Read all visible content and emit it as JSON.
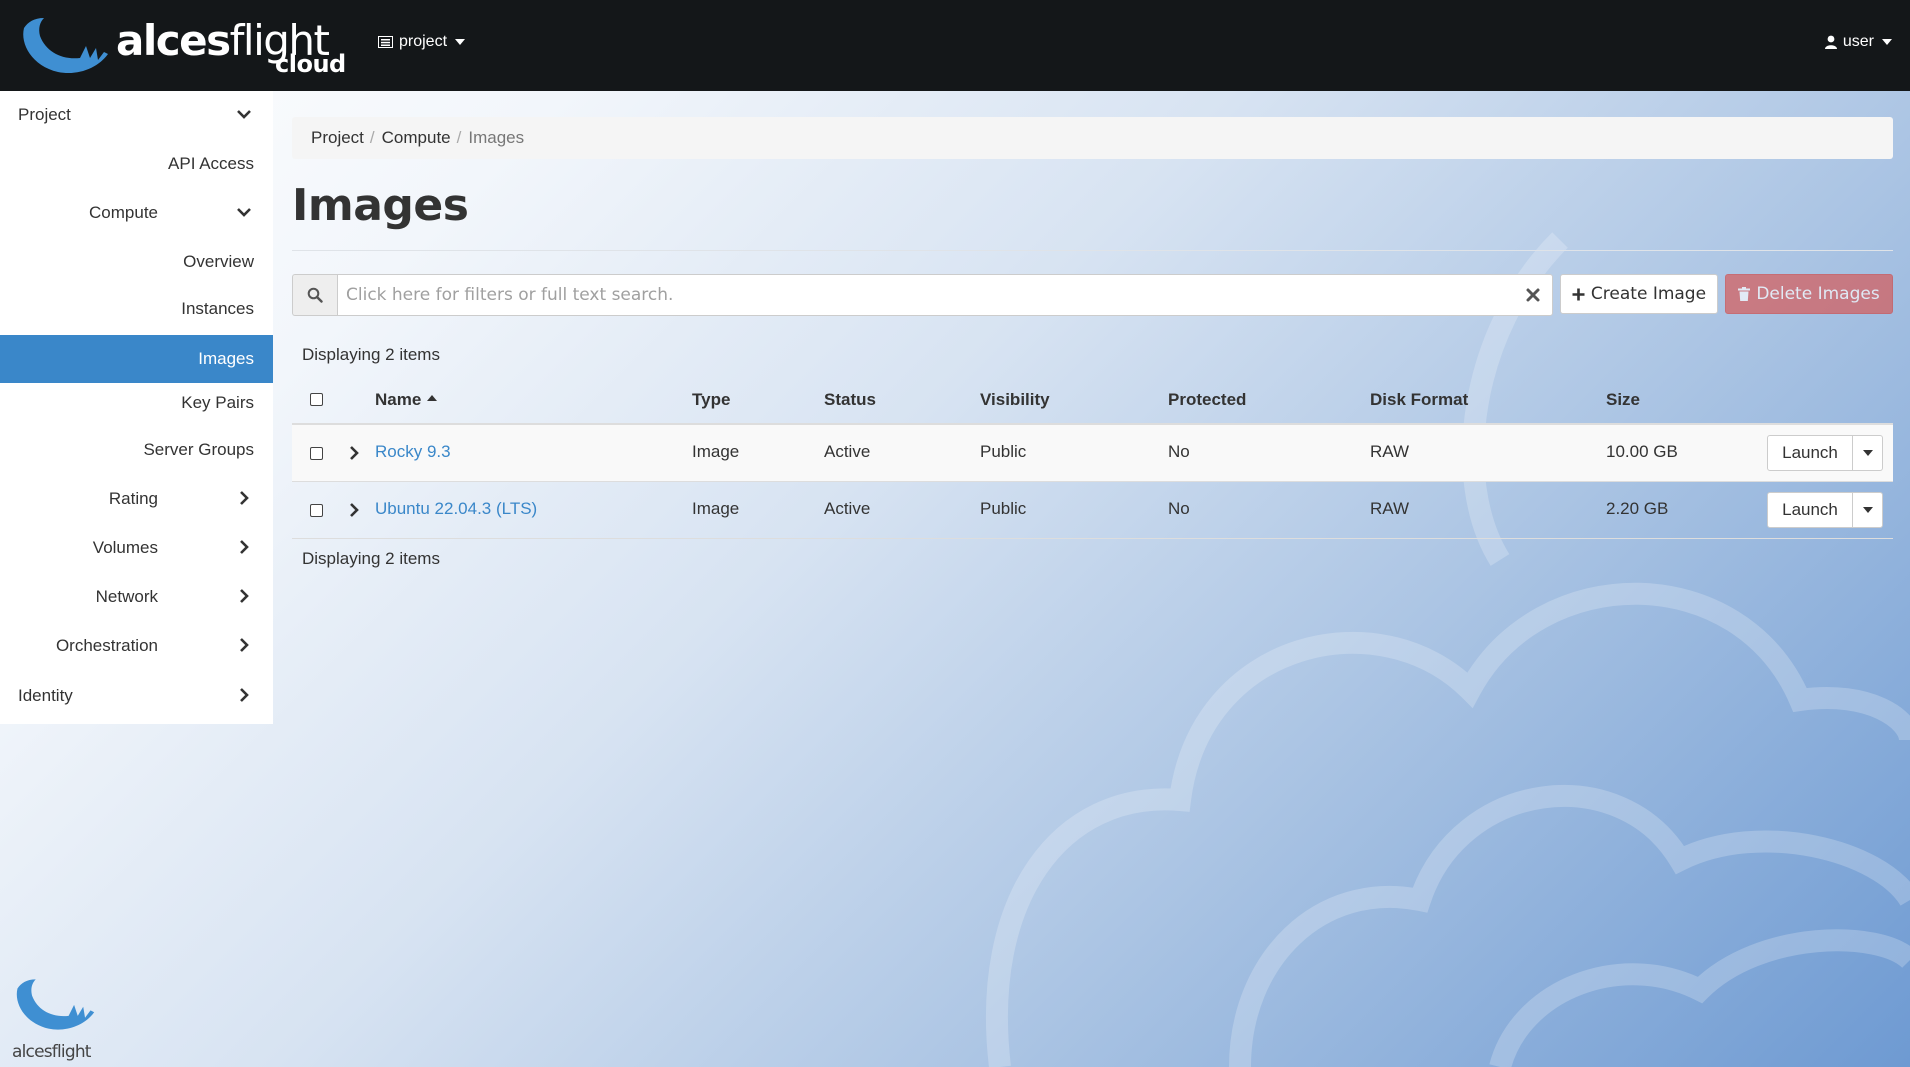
{
  "brand": {
    "name_bold": "alces",
    "name_light": "flight",
    "sub": "cloud"
  },
  "topnav": {
    "project_label": "project",
    "user_label": "user"
  },
  "sidebar": {
    "items": [
      {
        "label": "Project",
        "level": 0,
        "icon": "chevron-down-icon"
      },
      {
        "label": "API Access",
        "level": 2
      },
      {
        "label": "Compute",
        "level": 1,
        "icon": "chevron-down-icon"
      },
      {
        "label": "Overview",
        "level": 2
      },
      {
        "label": "Instances",
        "level": 2
      },
      {
        "label": "Images",
        "level": 2,
        "active": true
      },
      {
        "label": "Key Pairs",
        "level": 2
      },
      {
        "label": "Server Groups",
        "level": 2
      },
      {
        "label": "Rating",
        "level": 1,
        "icon": "chevron-right-icon"
      },
      {
        "label": "Volumes",
        "level": 1,
        "icon": "chevron-right-icon"
      },
      {
        "label": "Network",
        "level": 1,
        "icon": "chevron-right-icon"
      },
      {
        "label": "Orchestration",
        "level": 1,
        "icon": "chevron-right-icon"
      },
      {
        "label": "Identity",
        "level": 0,
        "icon": "chevron-right-icon"
      }
    ],
    "footer_logo_text": "alcesflight"
  },
  "breadcrumb": [
    "Project",
    "Compute",
    "Images"
  ],
  "page": {
    "title": "Images"
  },
  "search": {
    "placeholder": "Click here for filters or full text search.",
    "value": ""
  },
  "actions": {
    "create_label": "Create Image",
    "delete_label": "Delete Images"
  },
  "table": {
    "count_text": "Displaying 2 items",
    "headers": [
      "Name",
      "Type",
      "Status",
      "Visibility",
      "Protected",
      "Disk Format",
      "Size"
    ],
    "sorted_by": "Name",
    "rows": [
      {
        "name": "Rocky 9.3",
        "type": "Image",
        "status": "Active",
        "visibility": "Public",
        "protected": "No",
        "disk_format": "RAW",
        "size": "10.00 GB",
        "action": "Launch"
      },
      {
        "name": "Ubuntu 22.04.3 (LTS)",
        "type": "Image",
        "status": "Active",
        "visibility": "Public",
        "protected": "No",
        "disk_format": "RAW",
        "size": "2.20 GB",
        "action": "Launch"
      }
    ]
  },
  "colors": {
    "accent": "#3a87c9",
    "topbar": "#141719",
    "danger": "#d9534f",
    "logo_blue": "#3f8fd2"
  }
}
